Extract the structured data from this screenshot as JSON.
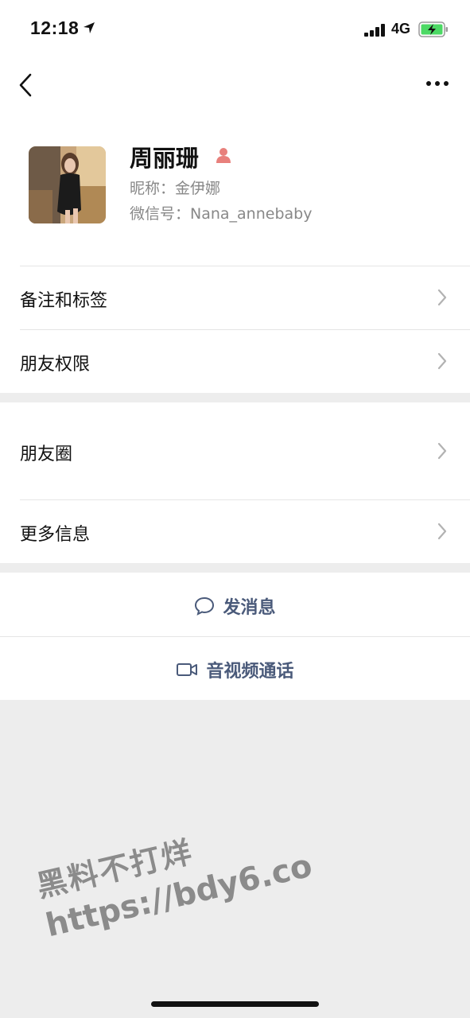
{
  "status_bar": {
    "time": "12:18",
    "network": "4G"
  },
  "profile": {
    "name": "周丽珊",
    "nickname": "昵称：金伊娜",
    "wechat_id": "微信号：Nana_annebaby"
  },
  "menu": {
    "remark_tags": "备注和标签",
    "permissions": "朋友权限",
    "moments": "朋友圈",
    "more_info": "更多信息"
  },
  "actions": {
    "send_message": "发消息",
    "video_call": "音视频通话"
  },
  "watermark": {
    "line1": "黑料不打烊",
    "line2": "https://bdy6.co"
  },
  "colors": {
    "accent": "#4a5a7a",
    "background": "#ededed",
    "battery_green": "#4cd964",
    "gender_icon": "#e8807c"
  }
}
